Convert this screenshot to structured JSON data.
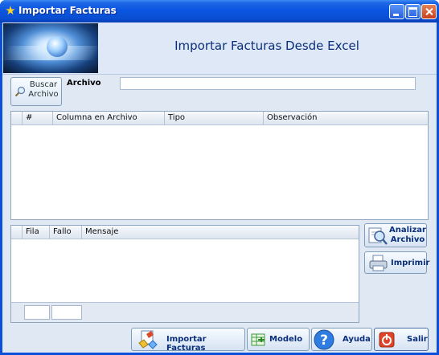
{
  "window": {
    "title": "Importar Facturas"
  },
  "header": {
    "title": "Importar Facturas Desde Excel"
  },
  "buscar": {
    "label_line1": "Buscar",
    "label_line2": "Archivo"
  },
  "archivo": {
    "label": "Archivo",
    "value": ""
  },
  "grid1": {
    "columns": [
      "#",
      "Columna en Archivo",
      "Tipo",
      "Observación"
    ]
  },
  "grid2": {
    "columns": [
      "Fila",
      "Fallo",
      "Mensaje"
    ]
  },
  "side_buttons": {
    "analizar_line1": "Analizar",
    "analizar_line2": "Archivo",
    "imprimir": "Imprimir"
  },
  "bottom_buttons": {
    "importar": "Importar Facturas",
    "modelo": "Modelo",
    "ayuda": "Ayuda",
    "salir": "Salir"
  },
  "colors": {
    "title_bar": "#0a56e0",
    "header_title": "#0a2f7a",
    "client_bg": "#e0e8f4"
  }
}
